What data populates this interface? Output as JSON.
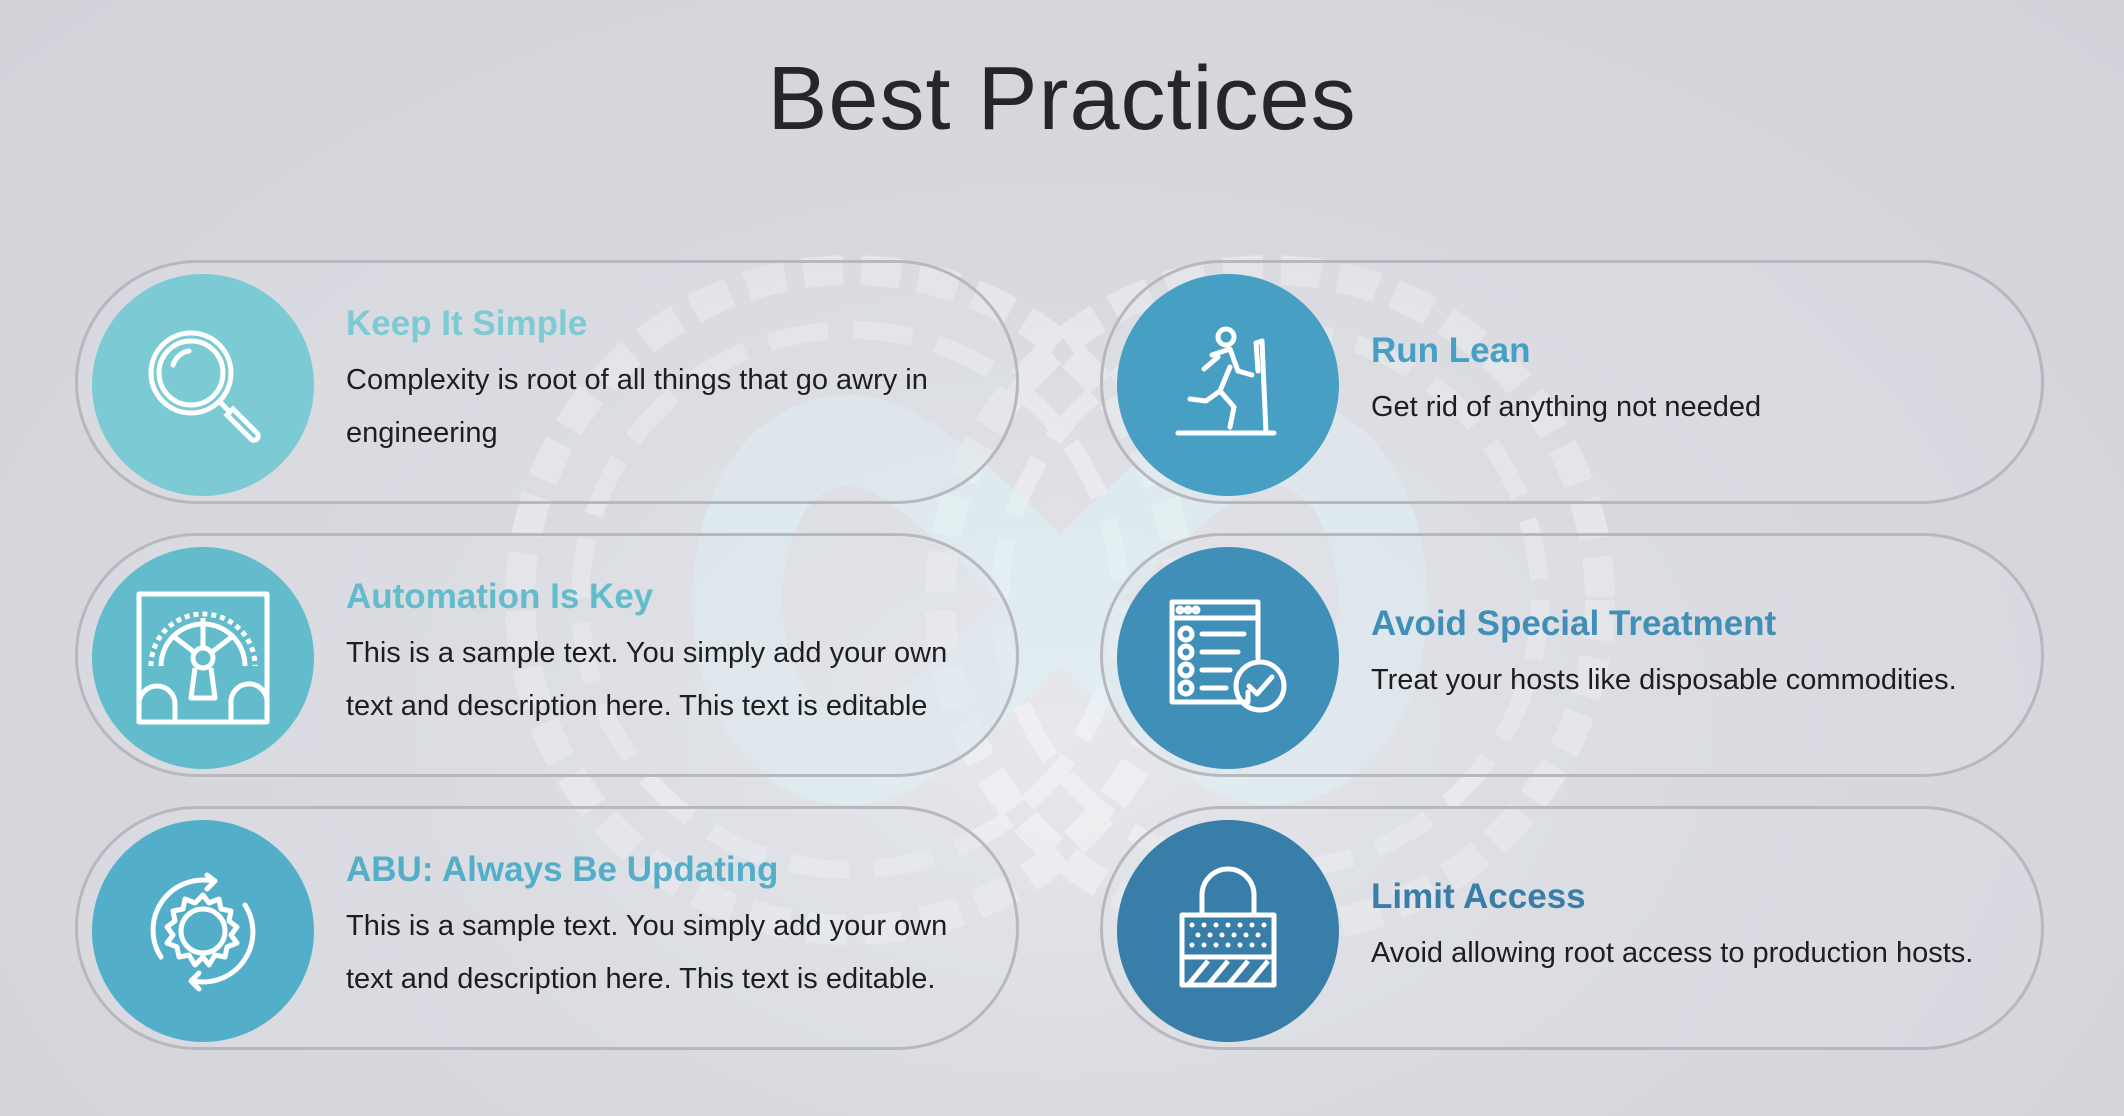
{
  "page": {
    "title": "Best Practices"
  },
  "colors": {
    "teal_light": "#7ccad3",
    "teal": "#62bccb",
    "teal_mid": "#53afc9",
    "blue": "#479fc4",
    "blue_mid": "#3f8fb8",
    "blue_dark": "#397ea8"
  },
  "cards": [
    {
      "title": "Keep It Simple",
      "description": "Complexity is root of all things that go awry in engineering",
      "icon": "magnifier-icon",
      "color": "#7ccad3",
      "title_color": "#7ccad3"
    },
    {
      "title": "Run Lean",
      "description": "Get rid of anything not needed",
      "icon": "runner-icon",
      "color": "#479fc4",
      "title_color": "#479fc4"
    },
    {
      "title": "Automation Is Key",
      "description": "This is a sample text. You simply add your own text and description here. This text is editable",
      "icon": "gears-icon",
      "color": "#62bccb",
      "title_color": "#62bccb"
    },
    {
      "title": "Avoid Special Treatment",
      "description": "Treat your hosts like disposable commodities.",
      "icon": "checklist-icon",
      "color": "#3f8fb8",
      "title_color": "#3f8fb8"
    },
    {
      "title": "ABU: Always Be Updating",
      "description": "This is a sample text. You simply add your own text and description here. This text is editable.",
      "icon": "gear-refresh-icon",
      "color": "#53afc9",
      "title_color": "#53afc9"
    },
    {
      "title": "Limit Access",
      "description": "Avoid allowing root access to production hosts.",
      "icon": "padlock-icon",
      "color": "#397ea8",
      "title_color": "#397ea8"
    }
  ]
}
